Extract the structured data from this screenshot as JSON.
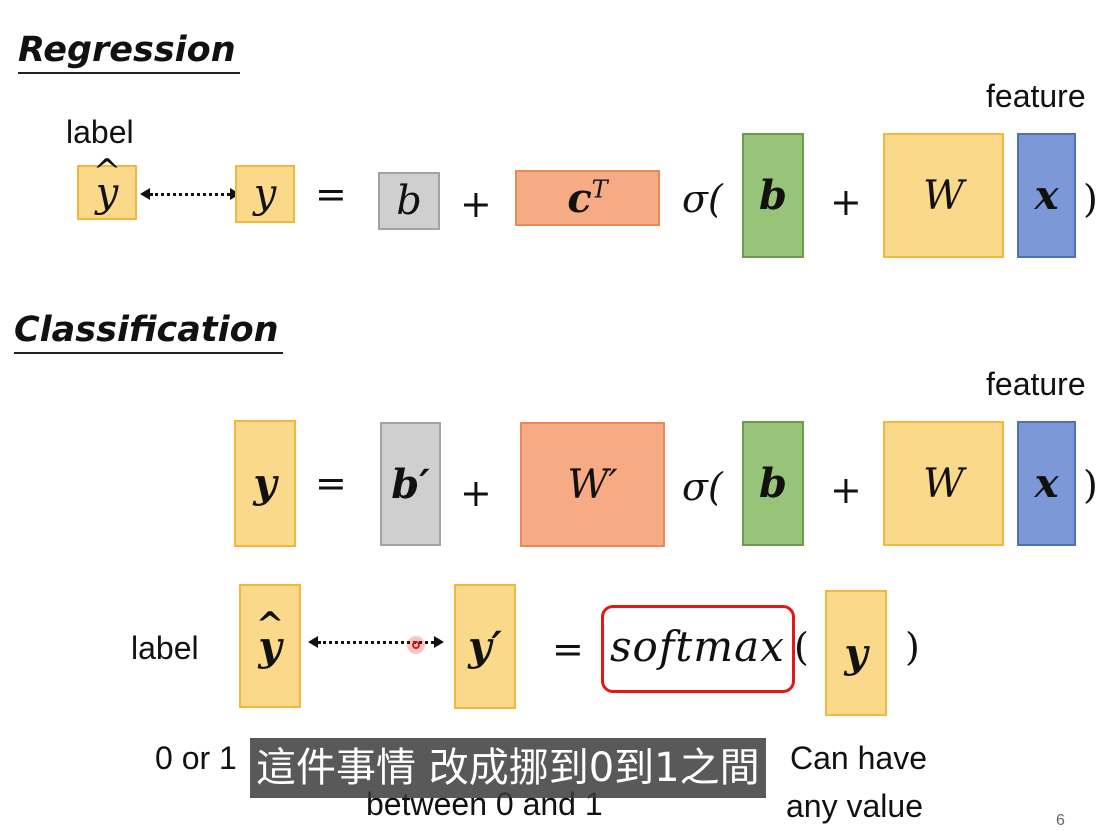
{
  "regression": {
    "heading": "Regression",
    "label": "label",
    "feature": "feature",
    "yhat": "y",
    "y": "y",
    "equals": "=",
    "b": "b",
    "plus1": "+",
    "cT_base": "c",
    "cT_sup": "T",
    "sigma": "σ(",
    "b_bold": "b",
    "plus2": "+",
    "W": "W",
    "x": "x",
    "close_paren": ")"
  },
  "classification": {
    "heading": "Classification",
    "feature": "feature",
    "y": "y",
    "equals": "=",
    "b_prime": "b′",
    "plus1": "+",
    "W_prime": "W′",
    "sigma": "σ(",
    "b_bold": "b",
    "plus2": "+",
    "W": "W",
    "x": "x",
    "close_paren": ")",
    "label": "label",
    "yhat": "y",
    "y_prime": "y′",
    "equals2": "=",
    "softmax": "softmax",
    "open_paren2": "(",
    "y2": "y",
    "close_paren2": ")",
    "note_left": "0 or 1",
    "note_mid_line2": "between 0 and 1",
    "note_right_line1": "Can have",
    "note_right_line2": "any value"
  },
  "subtitle": "這件事情 改成挪到0到1之間",
  "page_number": "6",
  "colors": {
    "yellow": "#fad98a",
    "gray": "#cfcfcf",
    "orange": "#f6ab85",
    "green": "#98c47a",
    "blue": "#7d98d6",
    "highlight_red": "#e01a12"
  }
}
